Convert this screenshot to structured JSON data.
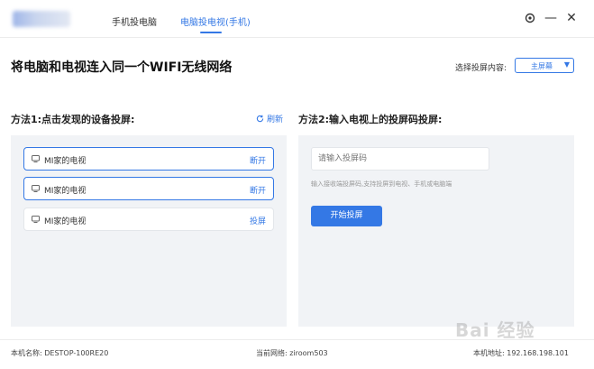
{
  "tabs": [
    {
      "label": "手机投电脑",
      "active": false
    },
    {
      "label": "电脑投电视(手机)",
      "active": true
    }
  ],
  "headline": "将电脑和电视连入同一个WIFI无线网络",
  "content_select": {
    "label": "选择投屏内容:",
    "value": "主屏幕"
  },
  "method1": {
    "title": "方法1:点击发现的设备投屏:",
    "refresh_label": "刷新",
    "devices": [
      {
        "name": "MI家的电视",
        "action": "断开",
        "active": true
      },
      {
        "name": "MI家的电视",
        "action": "断开",
        "active": true
      },
      {
        "name": "MI家的电视",
        "action": "投屏",
        "active": false
      }
    ]
  },
  "method2": {
    "title": "方法2:输入电视上的投屏码投屏:",
    "input_placeholder": "请输入投屏码",
    "hint": "输入接收端投屏码,支持投屏到电视、手机或电脑端",
    "start_label": "开始投屏"
  },
  "footer": {
    "device_name": "本机名称: DESTOP-100RE20",
    "network": "当前网络: ziroom503",
    "ip": "本机地址: 192.168.198.101"
  },
  "watermark": "Bai 经验",
  "colors": {
    "accent": "#3478e5",
    "panel_bg": "#f1f3f6"
  }
}
